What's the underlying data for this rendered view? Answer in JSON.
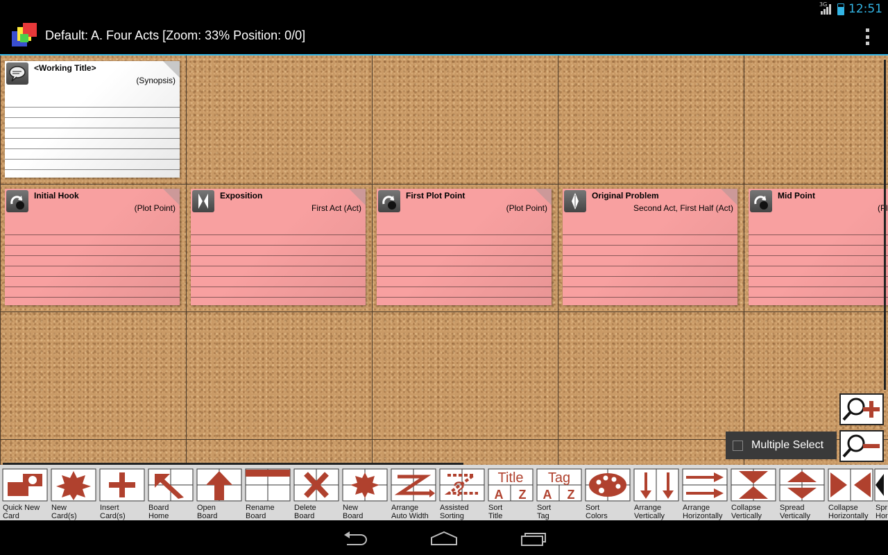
{
  "status_bar": {
    "network": "3G",
    "time": "12:51"
  },
  "action_bar": {
    "title": "Default: A. Four Acts [Zoom: 33% Position: 0/0]"
  },
  "cards": [
    {
      "title": "<Working Title>",
      "subtitle": "(Synopsis)",
      "color": "white",
      "icon": "speech-bubble-icon"
    },
    {
      "title": "Initial Hook",
      "subtitle": "(Plot Point)",
      "color": "pink",
      "icon": "hook-icon"
    },
    {
      "title": "Exposition",
      "subtitle": "First Act (Act)",
      "color": "pink",
      "icon": "act-icon"
    },
    {
      "title": "First Plot Point",
      "subtitle": "(Plot Point)",
      "color": "pink",
      "icon": "hook-icon"
    },
    {
      "title": "Original Problem",
      "subtitle": "Second Act, First Half (Act)",
      "color": "pink",
      "icon": "act-icon"
    },
    {
      "title": "Mid Point",
      "subtitle": "(Plot Point)",
      "color": "pink",
      "icon": "hook-icon"
    }
  ],
  "multi_select": {
    "label": "Multiple Select",
    "checked": false
  },
  "toolbar": [
    {
      "l1": "Quick New",
      "l2": "Card",
      "icon": "quick-new-card-icon"
    },
    {
      "l1": "New",
      "l2": "Card(s)",
      "icon": "new-card-icon"
    },
    {
      "l1": "Insert",
      "l2": "Card(s)",
      "icon": "insert-card-icon"
    },
    {
      "l1": "Board",
      "l2": "Home",
      "icon": "board-home-icon"
    },
    {
      "l1": "Open",
      "l2": "Board",
      "icon": "open-board-icon"
    },
    {
      "l1": "Rename",
      "l2": "Board",
      "icon": "rename-board-icon"
    },
    {
      "l1": "Delete",
      "l2": "Board",
      "icon": "delete-board-icon"
    },
    {
      "l1": "New",
      "l2": "Board",
      "icon": "new-board-icon"
    },
    {
      "l1": "Arrange",
      "l2": "Auto Width",
      "icon": "arrange-auto-width-icon"
    },
    {
      "l1": "Assisted",
      "l2": "Sorting",
      "icon": "assisted-sorting-icon"
    },
    {
      "l1": "Sort",
      "l2": "Title",
      "icon": "sort-title-icon",
      "g_top": "Title",
      "g_a": "A",
      "g_z": "Z"
    },
    {
      "l1": "Sort",
      "l2": "Tag",
      "icon": "sort-tag-icon",
      "g_top": "Tag",
      "g_a": "A",
      "g_z": "Z"
    },
    {
      "l1": "Sort",
      "l2": "Colors",
      "icon": "sort-colors-icon"
    },
    {
      "l1": "Arrange",
      "l2": "Vertically",
      "icon": "arrange-vertically-icon"
    },
    {
      "l1": "Arrange",
      "l2": "Horizontally",
      "icon": "arrange-horizontally-icon"
    },
    {
      "l1": "Collapse",
      "l2": "Vertically",
      "icon": "collapse-vertically-icon"
    },
    {
      "l1": "Spread",
      "l2": "Vertically",
      "icon": "spread-vertically-icon"
    },
    {
      "l1": "Collapse",
      "l2": "Horizontally",
      "icon": "collapse-horizontally-icon"
    },
    {
      "l1": "Spr",
      "l2": "Hor",
      "icon": "spread-horizontally-icon"
    }
  ],
  "colors": {
    "accent": "#33b5e5",
    "tool_red": "#b0412e",
    "card_pink": "#f8a0a0",
    "cork": "#c99a66"
  }
}
